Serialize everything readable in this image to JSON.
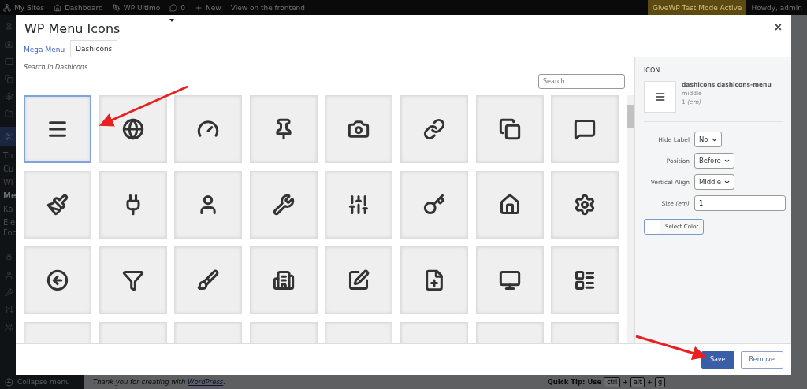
{
  "admin_bar": {
    "items": [
      {
        "label": "My Sites"
      },
      {
        "label": "Dashboard"
      },
      {
        "label": "WP Ultimo"
      },
      {
        "label": "0"
      },
      {
        "label": "New"
      },
      {
        "label": "View on the frontend"
      }
    ],
    "notice": "GiveWP Test Mode Active",
    "greeting": "Howdy, admin"
  },
  "sidebar": {
    "submenu": [
      {
        "label": "Th",
        "selected": false
      },
      {
        "label": "Cu",
        "selected": false
      },
      {
        "label": "Wi",
        "selected": false
      },
      {
        "label": "Me",
        "selected": true
      },
      {
        "label": "Ka",
        "selected": false
      },
      {
        "label": "Ele Foo",
        "selected": false
      }
    ],
    "collapse": "Collapse menu"
  },
  "dialog": {
    "title": "WP Menu Icons",
    "close": "×",
    "tabs": [
      {
        "label": "Mega Menu",
        "selected": false
      },
      {
        "label": "Dashicons",
        "selected": true
      }
    ],
    "hint": "Search in Dashicons.",
    "search": {
      "placeholder": "Search..."
    },
    "tiles": [
      {
        "selected": true
      },
      {
        "selected": false
      },
      {
        "selected": false
      },
      {
        "selected": false
      },
      {
        "selected": false
      },
      {
        "selected": false
      },
      {
        "selected": false
      },
      {
        "selected": false
      },
      {
        "selected": false
      },
      {
        "selected": false
      },
      {
        "selected": false
      },
      {
        "selected": false
      },
      {
        "selected": false
      },
      {
        "selected": false
      },
      {
        "selected": false
      },
      {
        "selected": false
      },
      {
        "selected": false
      },
      {
        "selected": false
      },
      {
        "selected": false
      },
      {
        "selected": false
      },
      {
        "selected": false
      },
      {
        "selected": false
      },
      {
        "selected": false
      },
      {
        "selected": false
      },
      {
        "selected": false
      },
      {
        "selected": false
      },
      {
        "selected": false
      },
      {
        "selected": false
      },
      {
        "selected": false
      },
      {
        "selected": false
      },
      {
        "selected": false
      },
      {
        "selected": false
      }
    ],
    "settings": {
      "heading": "ICON",
      "preview": {
        "class": "dashicons dashicons-menu",
        "align": "middle",
        "size": "1 *(em)*"
      },
      "fields": [
        {
          "kind": "select",
          "label": "Hide Label",
          "value": "No"
        },
        {
          "kind": "select",
          "label": "Position",
          "value": "Before"
        },
        {
          "kind": "select",
          "label": "Vertical Align",
          "value": "Middle"
        },
        {
          "kind": "input",
          "label": "Size *(em)*",
          "value": "1"
        }
      ],
      "color_button": "Select Color"
    },
    "buttons": [
      {
        "label": "Save",
        "kind": "primary"
      },
      {
        "label": "Remove",
        "kind": "secondary"
      }
    ]
  },
  "footer": {
    "thanks": "Thank you for creating with",
    "link": "WordPress",
    "link_suffix": ".",
    "quick_tip": "Quick Tip: Use",
    "keys": [
      "ctrl",
      "alt",
      "g"
    ],
    "separator": "+"
  }
}
